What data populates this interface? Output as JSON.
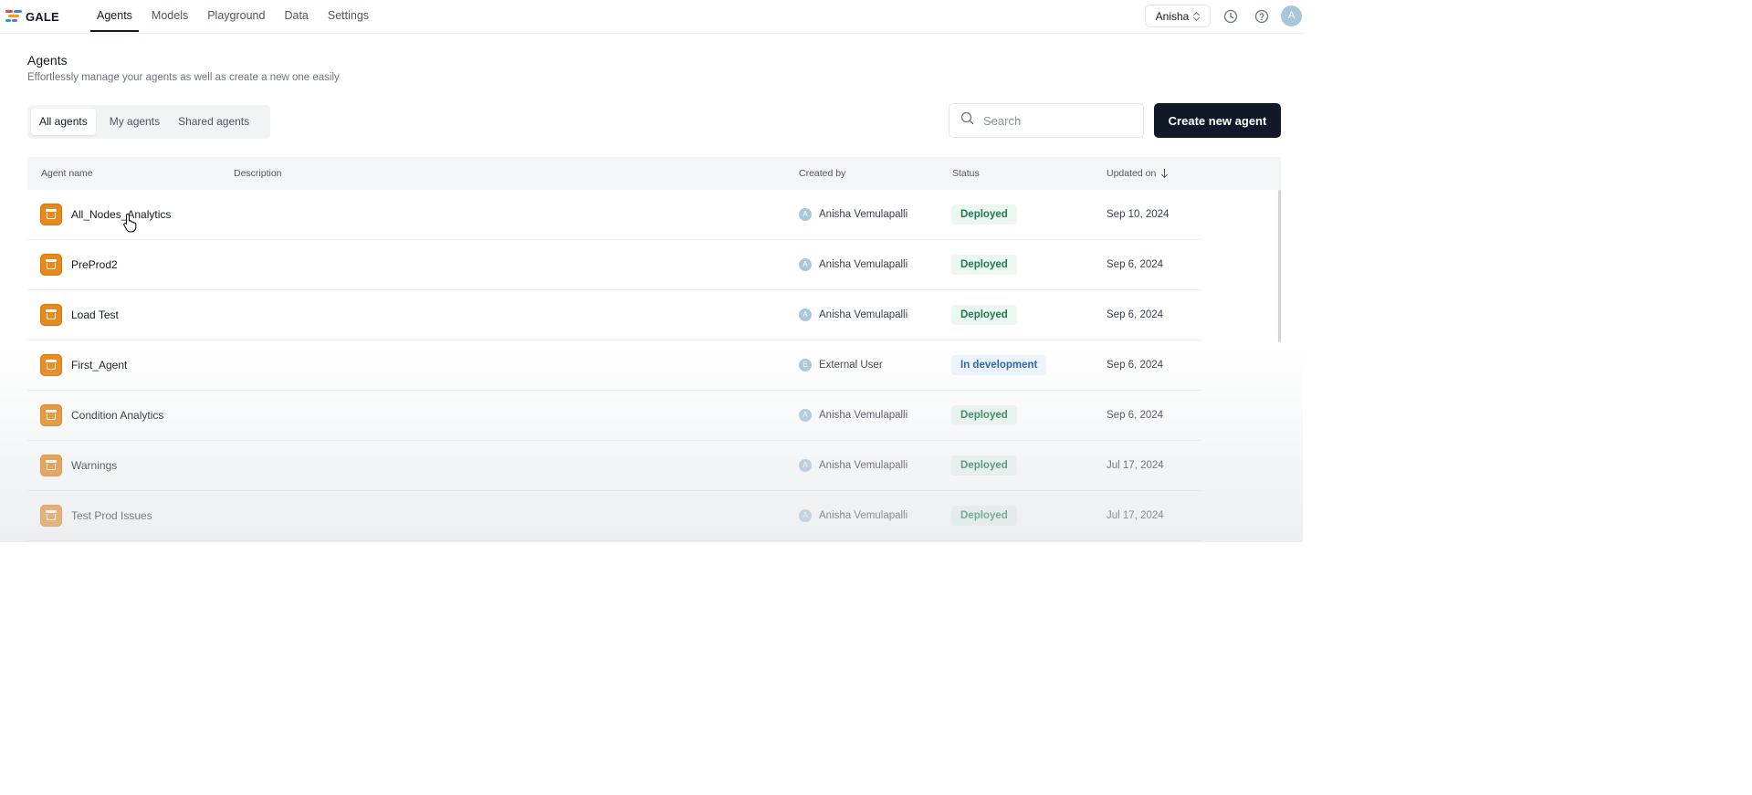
{
  "app": {
    "logo_text": "GALE",
    "nav": [
      {
        "label": "Agents",
        "active": true
      },
      {
        "label": "Models",
        "active": false
      },
      {
        "label": "Playground",
        "active": false
      },
      {
        "label": "Data",
        "active": false
      },
      {
        "label": "Settings",
        "active": false
      }
    ],
    "user_select": "Anisha",
    "icons": [
      "clock-icon",
      "help-icon"
    ],
    "avatar_initial": "A"
  },
  "header": {
    "title": "Agents",
    "subtitle": "Effortlessly manage your agents as well as create a new one easily"
  },
  "tabs": [
    {
      "label": "All agents",
      "active": true
    },
    {
      "label": "My agents",
      "active": false
    },
    {
      "label": "Shared agents",
      "active": false
    }
  ],
  "search": {
    "placeholder": "Search"
  },
  "create_button": "Create new agent",
  "table": {
    "columns": {
      "name": "Agent name",
      "description": "Description",
      "created_by": "Created by",
      "status": "Status",
      "updated_on": "Updated on"
    },
    "rows": [
      {
        "name": "All_Nodes_Analytics",
        "description": "",
        "creator_initial": "A",
        "created_by": "Anisha Vemulapalli",
        "status": "Deployed",
        "status_kind": "deployed",
        "updated_on": "Sep 10, 2024"
      },
      {
        "name": "PreProd2",
        "description": "",
        "creator_initial": "A",
        "created_by": "Anisha Vemulapalli",
        "status": "Deployed",
        "status_kind": "deployed",
        "updated_on": "Sep 6, 2024"
      },
      {
        "name": "Load Test",
        "description": "",
        "creator_initial": "A",
        "created_by": "Anisha Vemulapalli",
        "status": "Deployed",
        "status_kind": "deployed",
        "updated_on": "Sep 6, 2024"
      },
      {
        "name": "First_Agent",
        "description": "",
        "creator_initial": "E",
        "created_by": "External User",
        "status": "In development",
        "status_kind": "dev",
        "updated_on": "Sep 6, 2024"
      },
      {
        "name": "Condition Analytics",
        "description": "",
        "creator_initial": "A",
        "created_by": "Anisha Vemulapalli",
        "status": "Deployed",
        "status_kind": "deployed",
        "updated_on": "Sep 6, 2024"
      },
      {
        "name": "Warnings",
        "description": "",
        "creator_initial": "A",
        "created_by": "Anisha Vemulapalli",
        "status": "Deployed",
        "status_kind": "deployed",
        "updated_on": "Jul 17, 2024"
      },
      {
        "name": "Test Prod Issues",
        "description": "",
        "creator_initial": "A",
        "created_by": "Anisha Vemulapalli",
        "status": "Deployed",
        "status_kind": "deployed",
        "updated_on": "Jul 17, 2024"
      }
    ]
  },
  "colors": {
    "primary_button": "#111827",
    "agent_icon": "#e8891c",
    "deployed_text": "#1e7b4f",
    "deployed_bg": "#ecf7f1",
    "dev_text": "#2563a8",
    "dev_bg": "#edf4fd"
  }
}
